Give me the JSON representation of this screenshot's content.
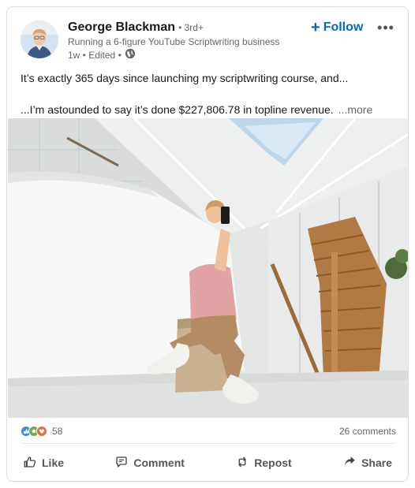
{
  "author": {
    "name": "George Blackman",
    "degree": "• 3rd+",
    "headline": "Running a 6-figure YouTube Scriptwriting business",
    "meta": "1w • Edited •"
  },
  "follow": {
    "label": "Follow",
    "color": "#0a66c2"
  },
  "post": {
    "line1": "It’s exactly 365 days since launching my scriptwriting course, and...",
    "line2": "...I’m astounded to say it’s done $227,806.78 in topline revenue.",
    "see_more": "...more"
  },
  "social": {
    "reaction_count": "58",
    "comments": "26 comments"
  },
  "actions": [
    {
      "label": "Like",
      "icon": "thumbs-up-icon"
    },
    {
      "label": "Comment",
      "icon": "comment-icon"
    },
    {
      "label": "Repost",
      "icon": "repost-icon"
    },
    {
      "label": "Share",
      "icon": "share-arrow-icon"
    }
  ]
}
